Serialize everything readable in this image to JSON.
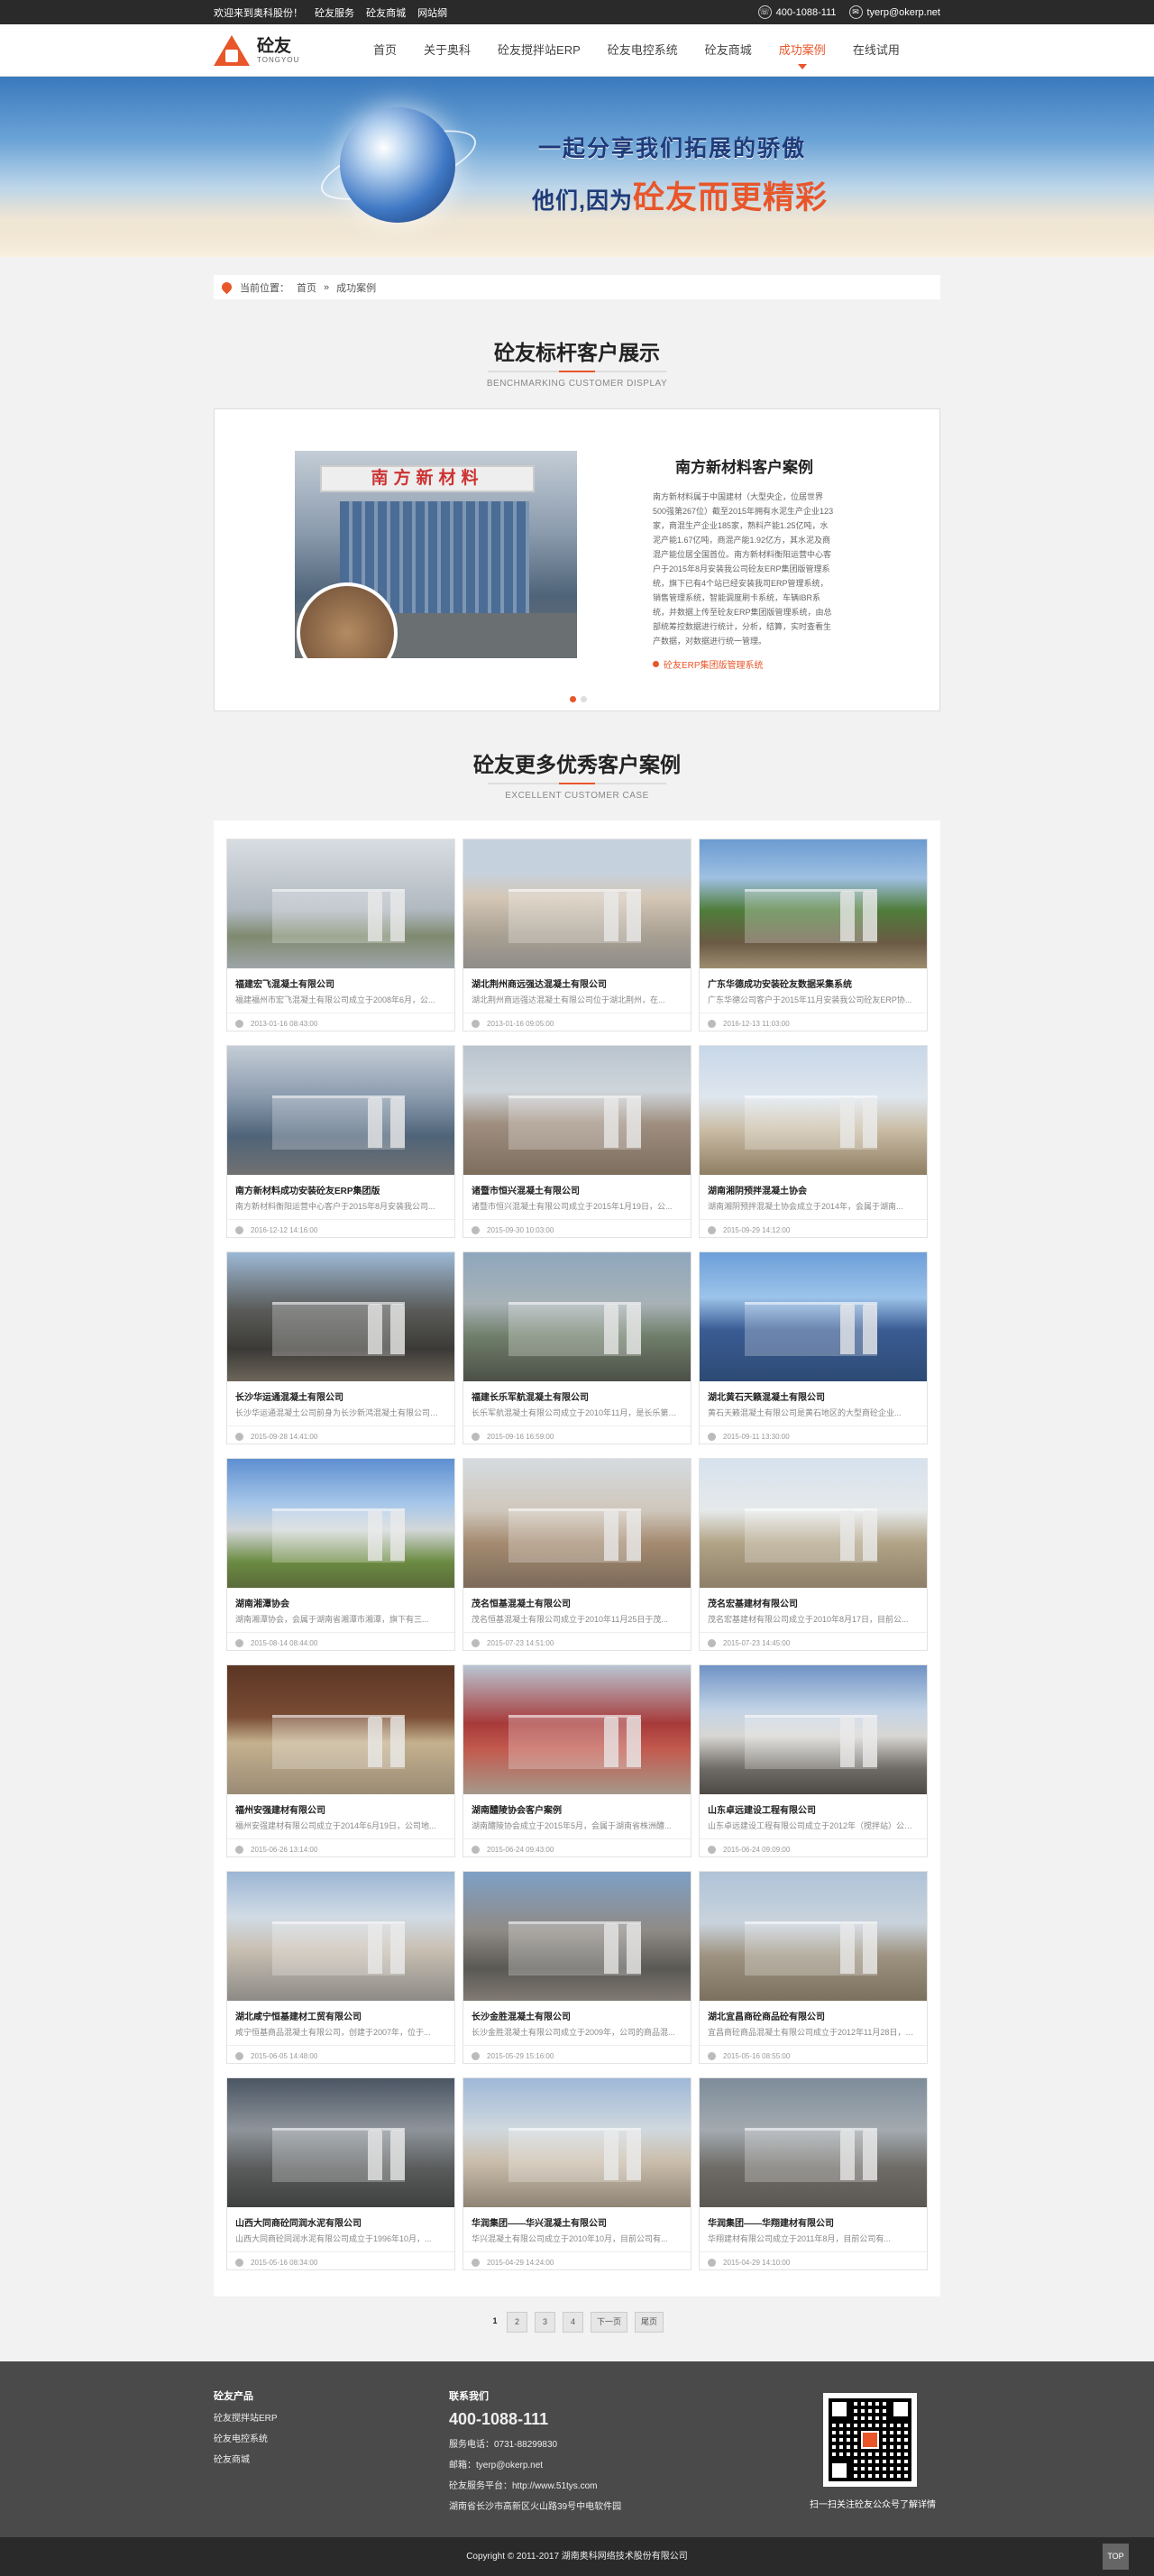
{
  "topbar": {
    "welcome": "欢迎来到奥科股份！",
    "links": [
      "砼友服务",
      "砼友商城",
      "网站纲"
    ],
    "phone": "400-1088-111",
    "email": "tyerp@okerp.net"
  },
  "header": {
    "logo_cn": "砼友",
    "logo_en": "TONGYOU",
    "nav": [
      {
        "label": "首页",
        "active": false
      },
      {
        "label": "关于奥科",
        "active": false
      },
      {
        "label": "砼友搅拌站ERP",
        "active": false
      },
      {
        "label": "砼友电控系统",
        "active": false
      },
      {
        "label": "砼友商城",
        "active": false
      },
      {
        "label": "成功案例",
        "active": true
      },
      {
        "label": "在线试用",
        "active": false
      }
    ]
  },
  "banner": {
    "line1": "一起分享我们拓展的骄傲",
    "line2_prefix": "他们,因为",
    "line2_highlight": "砼友而更精彩"
  },
  "breadcrumb": {
    "label": "当前位置：",
    "home": "首页",
    "sep": "»",
    "current": "成功案例"
  },
  "benchmark": {
    "title": "砼友标杆客户展示",
    "subtitle": "BENCHMARKING CUSTOMER DISPLAY",
    "featured_title": "南方新材料客户案例",
    "image_sign": "南方新材料",
    "featured_text": "南方新材料属于中国建材（大型央企，位居世界500强第267位）截至2015年拥有水泥生产企业123家，商混生产企业185家，熟料产能1.25亿吨，水泥产能1.67亿吨，商混产能1.92亿方，其水泥及商混产能位居全国首位。南方新材料衡阳运营中心客户于2015年8月安装我公司砼友ERP集团版管理系统，旗下已有4个站已经安装我司ERP管理系统，销售管理系统，智能调度刷卡系统，车辆IBR系统，并数据上传至砼友ERP集团版管理系统，由总部统筹控数据进行统计，分析，结算，实时查看生产数据，对数据进行统一管理。",
    "featured_link": "砼友ERP集团版管理系统",
    "slides": 2,
    "active_slide": 1
  },
  "more": {
    "title": "砼友更多优秀客户案例",
    "subtitle": "EXCELLENT CUSTOMER CASE"
  },
  "cases": [
    {
      "title": "福建宏飞混凝土有限公司",
      "desc": "福建福州市宏飞混凝土有限公司成立于2008年6月，公...",
      "date": "2013-01-16 08:43:00"
    },
    {
      "title": "湖北荆州商远强达混凝土有限公司",
      "desc": "湖北荆州商远强达混凝土有限公司位于湖北荆州，在...",
      "date": "2013-01-16 09:05:00"
    },
    {
      "title": "广东华德成功安装砼友数据采集系统",
      "desc": "广东华德公司客户于2015年11月安装我公司砼友ERP协...",
      "date": "2016-12-13 11:03:00"
    },
    {
      "title": "南方新材料成功安装砼友ERP集团版",
      "desc": "南方新材料衡阳运营中心客户于2015年8月安装我公司...",
      "date": "2016-12-12 14:16:00"
    },
    {
      "title": "诸暨市恒兴混凝土有限公司",
      "desc": "诸暨市恒兴混凝土有限公司成立于2015年1月19日，公...",
      "date": "2015-09-30 10:03:00"
    },
    {
      "title": "湖南湘阴预拌混凝土协会",
      "desc": "湖南湘阴预拌混凝土协会成立于2014年，会属于湖南...",
      "date": "2015-09-29 14:12:00"
    },
    {
      "title": "长沙华运通混凝土有限公司",
      "desc": "长沙华运通混凝土公司前身为长沙新鸿混凝土有限公司成立于...",
      "date": "2015-09-28 14:41:00"
    },
    {
      "title": "福建长乐军航混凝土有限公司",
      "desc": "长乐军航混凝土有限公司成立于2010年11月，是长乐第一...",
      "date": "2015-09-16 16:59:00"
    },
    {
      "title": "湖北黄石天籁混凝土有限公司",
      "desc": "黄石天籁混凝土有限公司是黄石地区的大型商砼企业...",
      "date": "2015-09-11 13:30:00"
    },
    {
      "title": "湖南湘潭协会",
      "desc": "湖南湘潭协会，会属于湖南省湘潭市湘潭，旗下有三...",
      "date": "2015-08-14 08:44:00"
    },
    {
      "title": "茂名恒基混凝土有限公司",
      "desc": "茂名恒基混凝土有限公司成立于2010年11月25日于茂...",
      "date": "2015-07-23 14:51:00"
    },
    {
      "title": "茂名宏基建材有限公司",
      "desc": "茂名宏基建材有限公司成立于2010年8月17日，目前公...",
      "date": "2015-07-23 14:45:00"
    },
    {
      "title": "福州安强建材有限公司",
      "desc": "福州安强建材有限公司成立于2014年6月19日，公司地...",
      "date": "2015-06-26 13:14:00"
    },
    {
      "title": "湖南醴陵协会客户案例",
      "desc": "湖南醴陵协会成立于2015年5月，会属于湖南省株洲醴...",
      "date": "2015-06-24 09:43:00"
    },
    {
      "title": "山东卓远建设工程有限公司",
      "desc": "山东卓远建设工程有限公司成立于2012年（搅拌站）公司成立于20...",
      "date": "2015-06-24 09:09:00"
    },
    {
      "title": "湖北咸宁恒基建材工贸有限公司",
      "desc": "咸宁恒基商品混凝土有限公司，创建于2007年，位于...",
      "date": "2015-06-05 14:48:00"
    },
    {
      "title": "长沙金胜混凝土有限公司",
      "desc": "长沙金胜混凝土有限公司成立于2009年，公司的商品混...",
      "date": "2015-05-29 15:16:00"
    },
    {
      "title": "湖北宜昌商砼商品砼有限公司",
      "desc": "宜昌商砼商品混凝土有限公司成立于2012年11月28日，目...",
      "date": "2015-05-16 08:55:00"
    },
    {
      "title": "山西大同商砼同润水泥有限公司",
      "desc": "山西大同商砼同润水泥有限公司成立于1996年10月，...",
      "date": "2015-05-16 08:34:00"
    },
    {
      "title": "华润集团——华兴混凝土有限公司",
      "desc": "华兴混凝土有限公司成立于2010年10月，目前公司有...",
      "date": "2015-04-29 14:24:00"
    },
    {
      "title": "华润集团——华翔建材有限公司",
      "desc": "华翔建材有限公司成立于2011年8月，目前公司有...",
      "date": "2015-04-29 14:10:00"
    }
  ],
  "pagination": {
    "current": "1",
    "pages": [
      "2",
      "3",
      "4"
    ],
    "next": "下一页",
    "last": "尾页"
  },
  "footer": {
    "products_title": "砼友产品",
    "products": [
      "砼友搅拌站ERP",
      "砼友电控系统",
      "砼友商城"
    ],
    "contact_title": "联系我们",
    "phone": "400-1088-111",
    "tel": "服务电话：0731-88299830",
    "email": "邮箱：tyerp@okerp.net",
    "platform": "砼友服务平台：http://www.51tys.com",
    "address": "湖南省长沙市高新区火山路39号中电软件园",
    "qr_text": "扫一扫关注砼友公众号了解详情",
    "copyright": "Copyright © 2011-2017 湖南奥科网络技术股份有限公司",
    "top": "TOP"
  },
  "colors": {
    "accent": "#e8562a",
    "topbar": "#2a2a2a",
    "footer": "#4a4a4a"
  }
}
